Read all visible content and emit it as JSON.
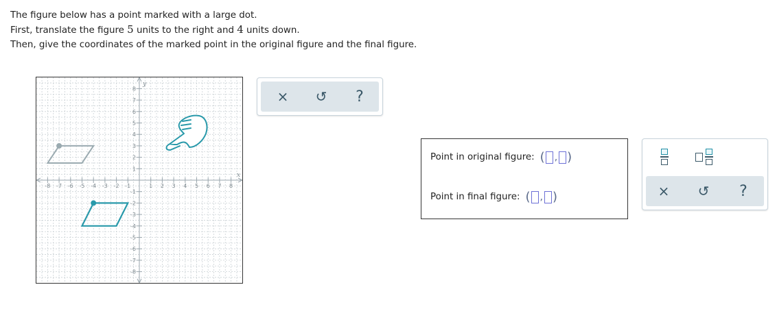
{
  "instructions": {
    "line1": "The figure below has a point marked with a large dot.",
    "line2_a": "First, translate the figure ",
    "line2_n1": "5",
    "line2_b": " units to the right and ",
    "line2_n2": "4",
    "line2_c": " units down.",
    "line3": "Then, give the coordinates of the marked point in the original figure and the final figure."
  },
  "graph": {
    "axis_x_label": "x",
    "axis_y_label": "y",
    "x_ticks": [
      "-8",
      "-7",
      "-6",
      "-5",
      "-4",
      "-3",
      "-2",
      "-1",
      "1",
      "2",
      "3",
      "4",
      "5",
      "6",
      "7",
      "8"
    ],
    "y_ticks": [
      "8",
      "7",
      "6",
      "5",
      "4",
      "3",
      "2",
      "1",
      "-1",
      "-2",
      "-3",
      "-4",
      "-5",
      "-6",
      "-7",
      "-8"
    ],
    "colors": {
      "original": "#9aaab0",
      "translated": "#2899aa",
      "grid": "#c9d0d4",
      "axis": "#9aa6ad",
      "hand": "#2899aa"
    },
    "original_figure": [
      [
        -7,
        3
      ],
      [
        -4,
        3
      ],
      [
        -5,
        1.5
      ],
      [
        -8,
        1.5
      ]
    ],
    "original_marked_point": [
      -7,
      3
    ],
    "translated_figure": [
      [
        -4,
        -2
      ],
      [
        -1,
        -2
      ],
      [
        -2,
        -4
      ],
      [
        -5,
        -4
      ]
    ],
    "translated_marked_point": [
      -4,
      -2
    ]
  },
  "tools_graph": {
    "clear_label": "×",
    "undo_label": "↺",
    "help_label": "?"
  },
  "answers": {
    "original_label": "Point in original figure:",
    "final_label": "Point in final figure:",
    "open_paren": "(",
    "comma": ",",
    "close_paren": ")"
  },
  "tools_math": {
    "clear_label": "×",
    "undo_label": "↺",
    "help_label": "?"
  }
}
